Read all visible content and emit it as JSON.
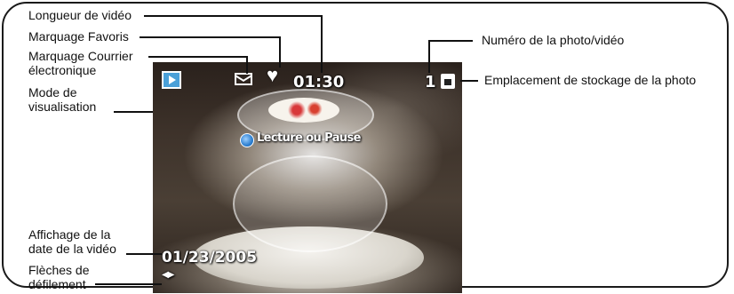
{
  "screen": {
    "video_length": "01:30",
    "photo_number": "1",
    "play_pause_label": "Lecture ou Pause",
    "video_date": "01/23/2005",
    "scroll_arrows": "◀▶",
    "favorite_symbol": "♥",
    "icons": [
      "review-mode-icon",
      "email-tag-icon",
      "favorite-heart-icon",
      "storage-location-icon",
      "play-pause-icon",
      "scroll-arrows-icon"
    ]
  },
  "callouts": {
    "video_length": "Longueur de vidéo",
    "favorites_tag": "Marquage Favoris",
    "email_tag_line1": "Marquage Courrier",
    "email_tag_line2": "électronique",
    "review_mode_line1": "Mode de",
    "review_mode_line2": "visualisation",
    "video_date_line1": "Affichage de la",
    "video_date_line2": "date de la vidéo",
    "scroll_arrows_line1": "Flèches de",
    "scroll_arrows_line2": "défilement",
    "photo_number": "Numéro de la photo/vidéo",
    "storage_location": "Emplacement de stockage de la photo"
  },
  "colors": {
    "frame": "#1a1a1a",
    "overlay_text": "#ffffff",
    "play_button": "#2d7fd0"
  }
}
